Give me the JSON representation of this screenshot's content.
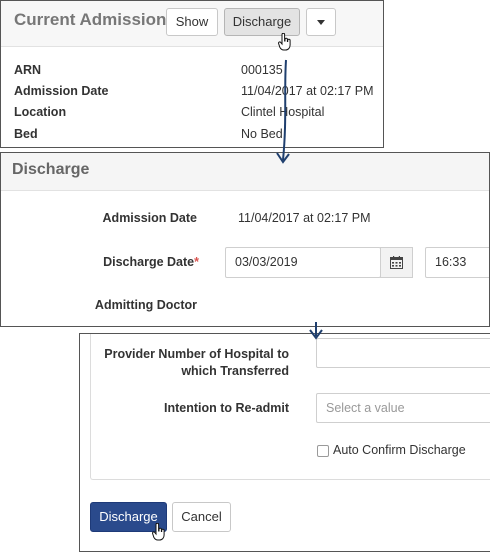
{
  "current_admission": {
    "title": "Current Admission",
    "buttons": {
      "show": "Show",
      "discharge": "Discharge"
    },
    "rows": [
      {
        "label": "ARN",
        "value": "000135"
      },
      {
        "label": "Admission Date",
        "value": "11/04/2017 at 02:17 PM"
      },
      {
        "label": "Location",
        "value": "Clintel Hospital"
      },
      {
        "label": "Bed",
        "value": "No Bed"
      }
    ]
  },
  "discharge_form": {
    "title": "Discharge",
    "admission_date_label": "Admission Date",
    "admission_date_value": "11/04/2017 at 02:17 PM",
    "discharge_date_label": "Discharge Date",
    "required_mark": "*",
    "discharge_date_value": "03/03/2019",
    "discharge_time_value": "16:33",
    "admitting_doctor_label": "Admitting Doctor"
  },
  "discharge_footer": {
    "provider_label_line1": "Provider Number of Hospital to",
    "provider_label_line2": "which Transferred",
    "provider_value": "",
    "readmit_label": "Intention to Re-admit",
    "readmit_placeholder": "Select a value",
    "auto_confirm_label": "Auto Confirm Discharge",
    "auto_confirm_checked": false,
    "discharge_button": "Discharge",
    "cancel_button": "Cancel"
  },
  "colors": {
    "primary_button": "#2a4a8c",
    "arrow": "#1f3f6e",
    "required": "#d9534f",
    "header_bg": "#f5f5f5"
  },
  "icons": [
    "caret-down-icon",
    "calendar-icon",
    "hand-pointer-icon",
    "arrow-down-icon",
    "checkbox-icon"
  ]
}
